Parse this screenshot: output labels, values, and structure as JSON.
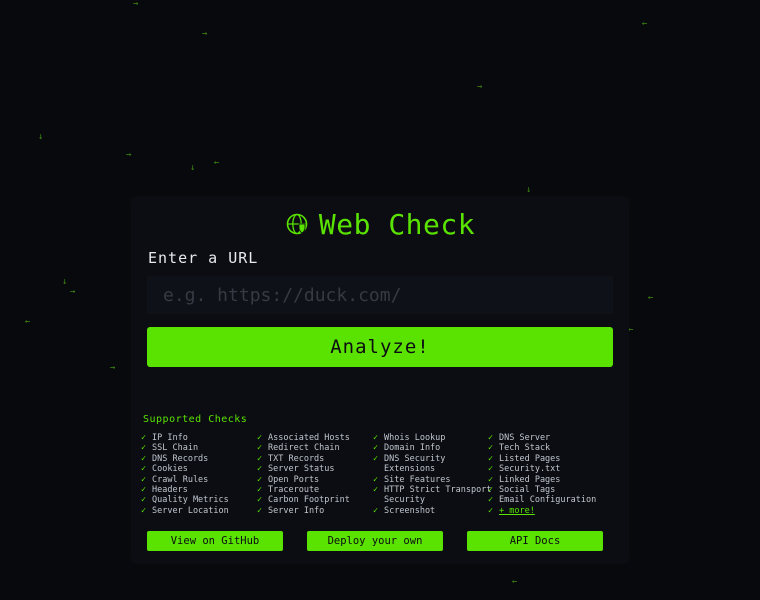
{
  "app": {
    "title": "Web Check",
    "logo_icon": "globe-shield-icon",
    "accent_color": "#5ae300",
    "background_color": "#07090d",
    "card_color": "#0b0d12"
  },
  "form": {
    "label": "Enter a URL",
    "placeholder": "e.g. https://duck.com/",
    "value": "",
    "submit_label": "Analyze!"
  },
  "checks": {
    "heading": "Supported Checks",
    "check_icon": "check-mark-icon",
    "columns": [
      [
        "IP Info",
        "SSL Chain",
        "DNS Records",
        "Cookies",
        "Crawl Rules",
        "Headers",
        "Quality Metrics",
        "Server Location"
      ],
      [
        "Associated Hosts",
        "Redirect Chain",
        "TXT Records",
        "Server Status",
        "Open Ports",
        "Traceroute",
        "Carbon Footprint",
        "Server Info"
      ],
      [
        "Whois Lookup",
        "Domain Info",
        "DNS Security Extensions",
        "Site Features",
        "HTTP Strict Transport Security",
        "Screenshot"
      ],
      [
        "DNS Server",
        "Tech Stack",
        "Listed Pages",
        "Security.txt",
        "Linked Pages",
        "Social Tags",
        "Email Configuration"
      ]
    ],
    "more_label": "+ more!"
  },
  "footer": {
    "github_label": "View on GitHub",
    "deploy_label": "Deploy your own",
    "api_label": "API Docs"
  },
  "background_glyphs": [
    "→",
    "→",
    "←",
    "→",
    "↓",
    "→",
    "↓",
    "↓",
    "←",
    "↓",
    "→",
    "←",
    "←",
    "←",
    "→",
    "↓",
    "←"
  ]
}
